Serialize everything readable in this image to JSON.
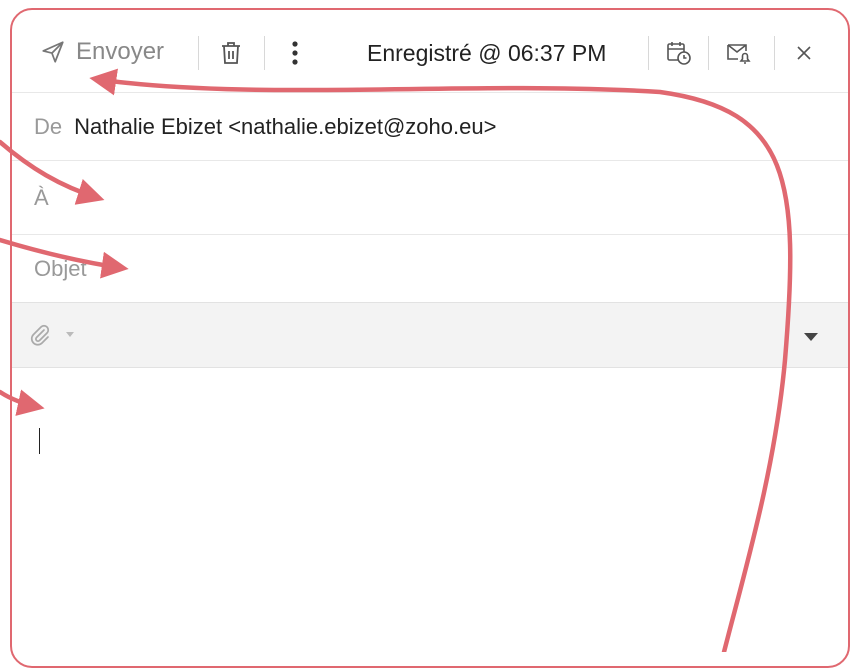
{
  "toolbar": {
    "send_label": "Envoyer",
    "saved_status": "Enregistré @ 06:37 PM",
    "icons": [
      "send-icon",
      "trash-icon",
      "more-vertical-icon",
      "schedule-icon",
      "reminder-icon",
      "close-icon"
    ]
  },
  "fields": {
    "from_label": "De",
    "from_value": "Nathalie Ebizet <nathalie.ebizet@zoho.eu>",
    "to_label": "À",
    "subject_label": "Objet"
  },
  "colors": {
    "annotation": "#e06870",
    "muted_text": "#999999",
    "primary_text": "#222222"
  }
}
